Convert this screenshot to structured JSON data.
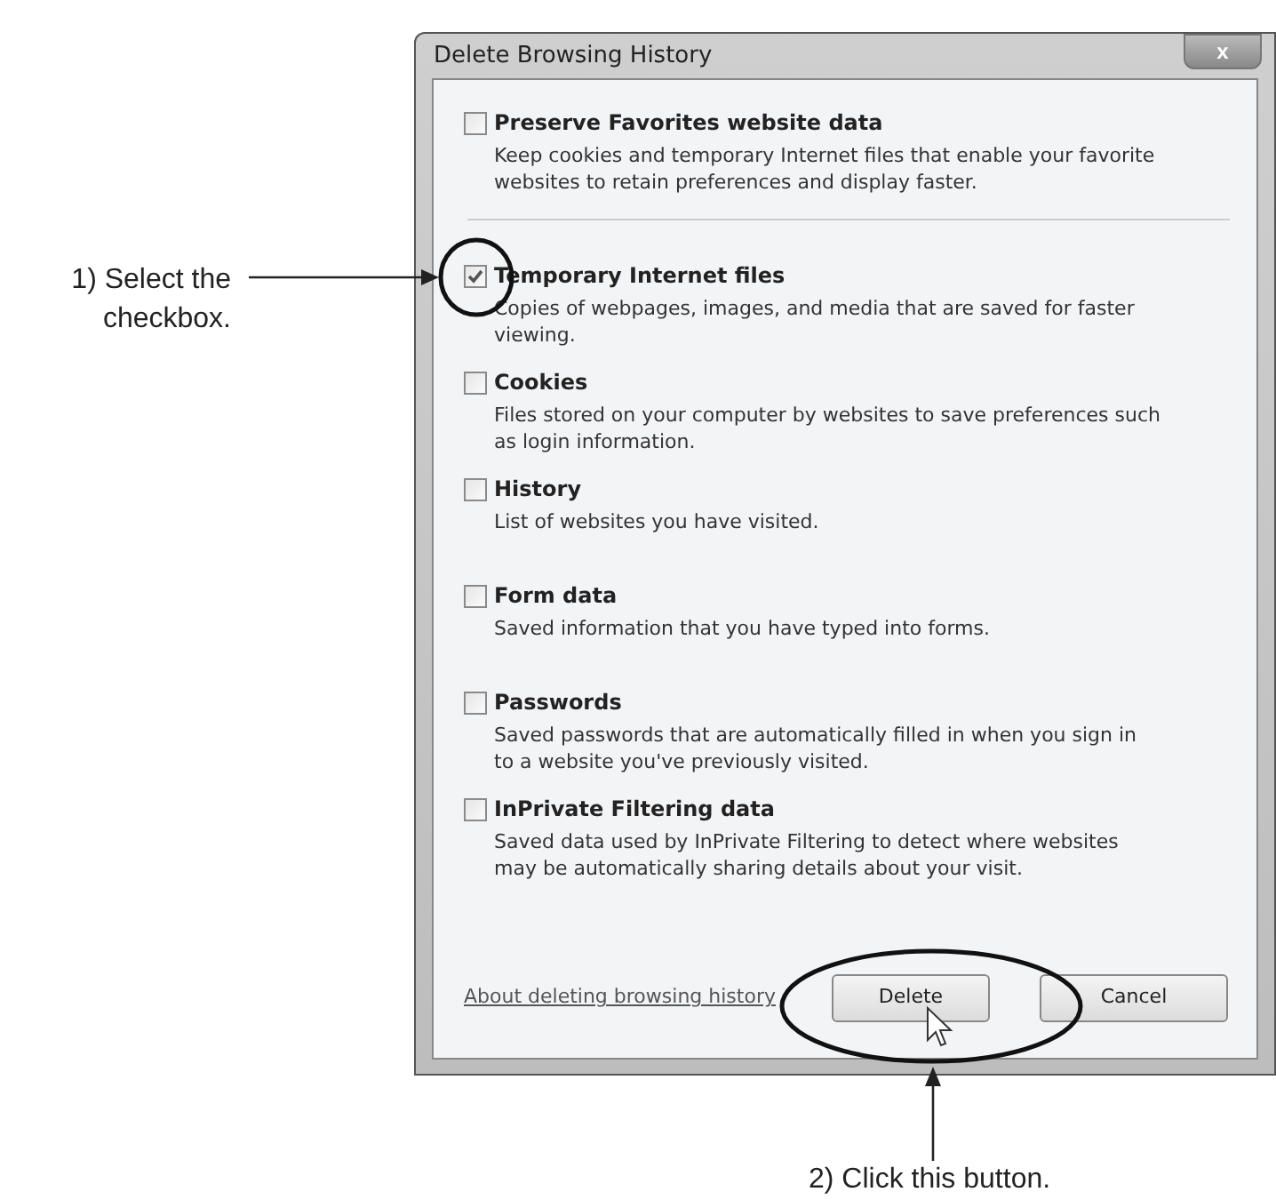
{
  "window": {
    "title": "Delete Browsing History",
    "close": "x"
  },
  "options": [
    {
      "label": "Preserve Favorites website data",
      "description": "Keep cookies and temporary Internet files that enable your favorite websites to retain preferences and display faster.",
      "checked": false
    },
    {
      "label": "Temporary Internet files",
      "description": "Copies of webpages, images, and media that are saved for faster viewing.",
      "checked": true
    },
    {
      "label": "Cookies",
      "description": "Files stored on your computer by websites to save preferences such as login information.",
      "checked": false
    },
    {
      "label": "History",
      "description": "List of websites you have visited.",
      "checked": false
    },
    {
      "label": "Form data",
      "description": "Saved information that you have typed into forms.",
      "checked": false
    },
    {
      "label": "Passwords",
      "description": "Saved passwords that are automatically filled in when you sign in to a website you've previously visited.",
      "checked": false
    },
    {
      "label": "InPrivate Filtering data",
      "description": "Saved data used by InPrivate Filtering to detect where websites may be automatically sharing details about your visit.",
      "checked": false
    }
  ],
  "footer": {
    "link": "About deleting browsing history",
    "buttons": [
      "Delete",
      "Cancel"
    ]
  },
  "callouts": [
    "1) Select the checkbox.",
    "2) Click this button."
  ]
}
